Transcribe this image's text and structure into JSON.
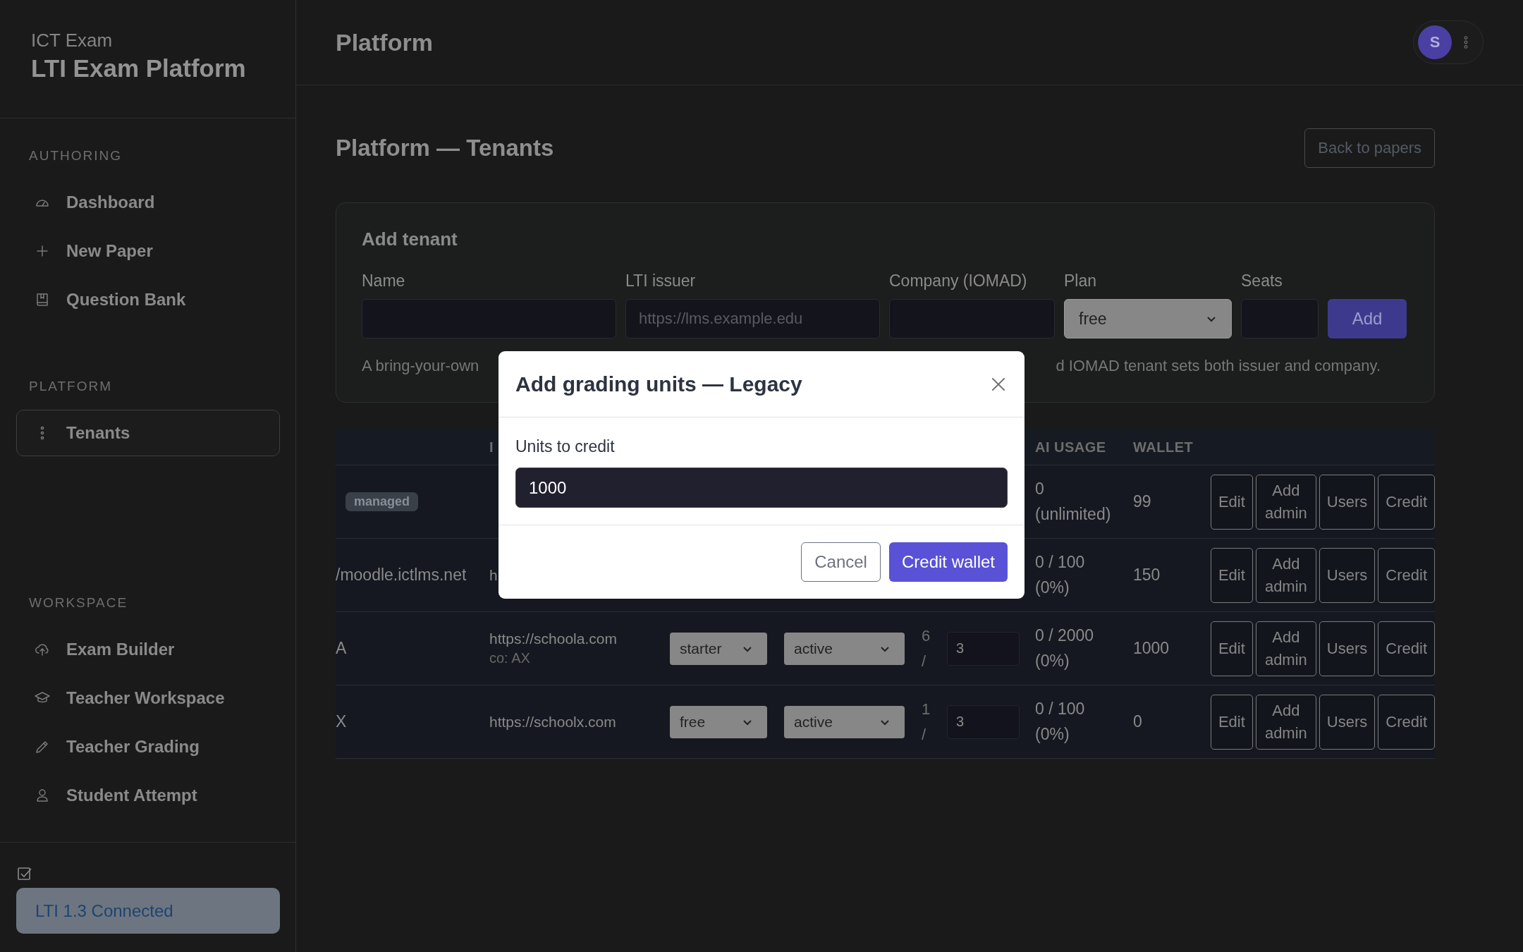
{
  "brand": {
    "subtitle": "ICT Exam",
    "title": "LTI Exam Platform"
  },
  "sidebar": {
    "sections": [
      {
        "heading": "AUTHORING",
        "items": [
          {
            "label": "Dashboard",
            "selected": false
          },
          {
            "label": "New Paper",
            "selected": false
          },
          {
            "label": "Question Bank",
            "selected": false
          }
        ]
      },
      {
        "heading": "PLATFORM",
        "items": [
          {
            "label": "Tenants",
            "selected": true
          }
        ]
      },
      {
        "heading": "WORKSPACE",
        "items": [
          {
            "label": "Exam Builder",
            "selected": false
          },
          {
            "label": "Teacher Workspace",
            "selected": false
          },
          {
            "label": "Teacher Grading",
            "selected": false
          },
          {
            "label": "Student Attempt",
            "selected": false
          }
        ]
      }
    ],
    "footer": {
      "status": "LTI 1.3 Connected"
    }
  },
  "header": {
    "title": "Platform",
    "avatar": "S"
  },
  "page": {
    "title": "Platform — Tenants",
    "back_button": "Back to papers"
  },
  "add_tenant": {
    "title": "Add tenant",
    "fields": [
      {
        "label": "Name",
        "kind": "text"
      },
      {
        "label": "LTI issuer",
        "kind": "text",
        "placeholder": "https://lms.example.edu"
      },
      {
        "label": "Company (IOMAD)",
        "kind": "text"
      },
      {
        "label": "Plan",
        "kind": "select",
        "value": "free"
      },
      {
        "label": "Seats",
        "kind": "text"
      }
    ],
    "submit": "Add",
    "help_start": "A bring-your-own",
    "help_end": "d IOMAD tenant sets both issuer and company."
  },
  "table": {
    "header": {
      "column_2": "I",
      "ai_usage": "AI USAGE",
      "wallet": "WALLET"
    },
    "rows": [
      {
        "badge": "managed",
        "ai_usage": "0 (unlimited)",
        "wallet": "99",
        "actions": [
          "Edit",
          "Add admin",
          "Users",
          "Credit"
        ]
      },
      {
        "name": "/moodle.ictlms.net",
        "issuer": "h",
        "ai_usage": "0 / 100 (0%)",
        "wallet": "150",
        "actions": [
          "Edit",
          "Add admin",
          "Users",
          "Credit"
        ]
      },
      {
        "name": "A",
        "issuer": "https://schoola.com",
        "company": "co: AX",
        "plan": "starter",
        "status": "active",
        "seats_used": "6 /",
        "seats": "3",
        "ai_usage": "0 / 2000 (0%)",
        "wallet": "1000",
        "actions": [
          "Edit",
          "Add admin",
          "Users",
          "Credit"
        ]
      },
      {
        "name": "X",
        "issuer": "https://schoolx.com",
        "plan": "free",
        "status": "active",
        "seats_used": "1 /",
        "seats": "3",
        "ai_usage": "0 / 100 (0%)",
        "wallet": "0",
        "actions": [
          "Edit",
          "Add admin",
          "Users",
          "Credit"
        ]
      }
    ]
  },
  "modal": {
    "title": "Add grading units — Legacy",
    "field_label": "Units to credit",
    "value": "1000",
    "cancel": "Cancel",
    "confirm": "Credit wallet"
  }
}
